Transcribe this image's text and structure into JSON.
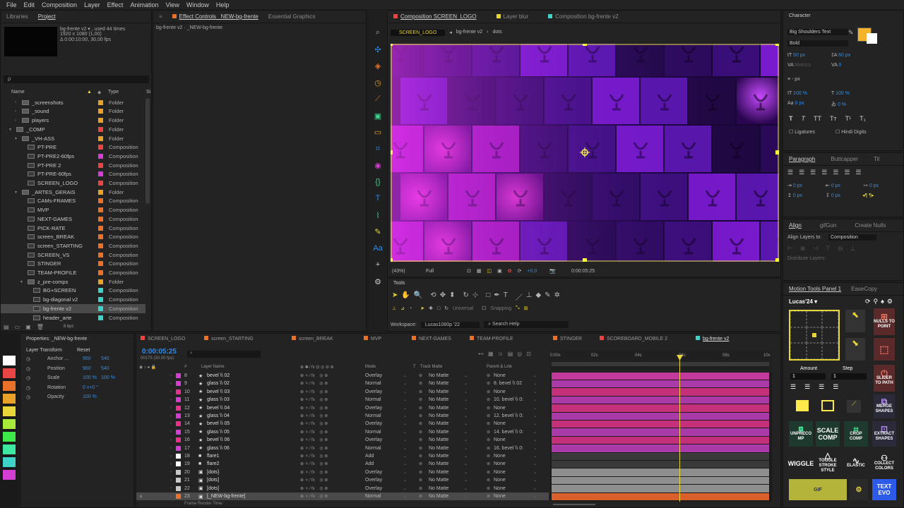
{
  "menu": [
    "File",
    "Edit",
    "Composition",
    "Layer",
    "Effect",
    "Animation",
    "View",
    "Window",
    "Help"
  ],
  "project": {
    "tabs": [
      "Libraries",
      "Project"
    ],
    "item_info": "bg-frente v2 ▾ , used 44 times",
    "item_dims": "1920 x 1080 (1,00)",
    "item_dur": "Δ 0:00:10:00, 30,00 fps",
    "search_placeholder": "ρ",
    "col_name": "Name",
    "col_type": "Type",
    "col_size": "Si",
    "items": [
      {
        "indent": 1,
        "name": "_screenshots",
        "type": "Folder",
        "color": "#e8a22a",
        "folder": true,
        "open": false
      },
      {
        "indent": 1,
        "name": "_sound",
        "type": "Folder",
        "color": "#e8a22a",
        "folder": true,
        "open": false
      },
      {
        "indent": 1,
        "name": "players",
        "type": "Folder",
        "color": "#e8a22a",
        "folder": true,
        "open": false
      },
      {
        "indent": 0,
        "name": "_COMP",
        "type": "Folder",
        "color": "#e84545",
        "folder": true,
        "open": true
      },
      {
        "indent": 1,
        "name": "_VH-ASS",
        "type": "Folder",
        "color": "#e8a22a",
        "folder": true,
        "open": true
      },
      {
        "indent": 2,
        "name": "PT-PRE",
        "type": "Composition",
        "color": "#e84545"
      },
      {
        "indent": 2,
        "name": "PT-PRE2-60fps",
        "type": "Composition",
        "color": "#d23fd2"
      },
      {
        "indent": 2,
        "name": "PT-PRE 2",
        "type": "Composition",
        "color": "#e84545"
      },
      {
        "indent": 2,
        "name": "PT-PRE-60fps",
        "type": "Composition",
        "color": "#d23fd2"
      },
      {
        "indent": 2,
        "name": "SCREEN_LOGO",
        "type": "Composition",
        "color": "#e84545"
      },
      {
        "indent": 1,
        "name": "_ARTES_GERAIS",
        "type": "Folder",
        "color": "#e8a22a",
        "folder": true,
        "open": true
      },
      {
        "indent": 2,
        "name": "CAMs-FRAMES",
        "type": "Composition",
        "color": "#e8722a"
      },
      {
        "indent": 2,
        "name": "MVP",
        "type": "Composition",
        "color": "#e8722a"
      },
      {
        "indent": 2,
        "name": "NEXT-GAMES",
        "type": "Composition",
        "color": "#e8722a"
      },
      {
        "indent": 2,
        "name": "PICK-RATE",
        "type": "Composition",
        "color": "#e8722a"
      },
      {
        "indent": 2,
        "name": "screen_BREAK",
        "type": "Composition",
        "color": "#e8722a"
      },
      {
        "indent": 2,
        "name": "screen_STARTING",
        "type": "Composition",
        "color": "#e8722a"
      },
      {
        "indent": 2,
        "name": "SCREEN_VS",
        "type": "Composition",
        "color": "#e8722a"
      },
      {
        "indent": 2,
        "name": "STINGER",
        "type": "Composition",
        "color": "#e8722a"
      },
      {
        "indent": 2,
        "name": "TEAM-PROFILE",
        "type": "Composition",
        "color": "#e8722a"
      },
      {
        "indent": 2,
        "name": "z_pre-comps",
        "type": "Folder",
        "color": "#e8a22a",
        "folder": true,
        "open": true
      },
      {
        "indent": 3,
        "name": "BG+SCREEN",
        "type": "Composition",
        "color": "#3fd2c8"
      },
      {
        "indent": 3,
        "name": "bg-diagonal v2",
        "type": "Composition",
        "color": "#3fd2c8"
      },
      {
        "indent": 3,
        "name": "bg-frente v2",
        "type": "Composition",
        "color": "#3fd2c8",
        "selected": true
      },
      {
        "indent": 3,
        "name": "header_arte",
        "type": "Composition",
        "color": "#3fd2c8"
      }
    ],
    "bpc": "8 bpc"
  },
  "effect_controls": {
    "tab": "Effect Controls _NEW-bg-frente",
    "tab2": "Essential Graphics",
    "subtitle": "bg-frente v2 · _NEW-bg-frente"
  },
  "viewer": {
    "tabs": [
      "Composition SCREEN_LOGO",
      "Layer blur",
      "Composition bg-frente v2"
    ],
    "breadcrumbs": [
      "SCREEN_LOGO",
      "bg-frente v2",
      "dots"
    ],
    "zoom": "(43%)",
    "resolution": "Full",
    "exposure": "+0,0",
    "timecode": "0:00:05:25"
  },
  "tools_panel": {
    "title": "Tools",
    "universal": "Universal",
    "snapping": "Snapping",
    "workspace_label": "Workspace:",
    "workspace": "Lucas1080p '22",
    "search_help": "Search Help"
  },
  "character": {
    "title": "Character",
    "font": "Big Shoulders Text",
    "style": "Bold",
    "size": "50 px",
    "leading": "60 px",
    "kerning": "Metrics",
    "tracking": "0",
    "stroke": "- px",
    "vscale": "100 %",
    "hscale": "100 %",
    "baseline": "0 px",
    "tsume": "0 %",
    "ligatures": "Ligatures",
    "hindi": "Hindi Digits",
    "color_fill": "#f4b429"
  },
  "paragraph": {
    "tabs": [
      "Paragraph",
      "Buttcapper",
      "Til"
    ],
    "vals": [
      "0 px",
      "0 px",
      "0 px",
      "0 px",
      "0 px"
    ]
  },
  "align": {
    "tabs": [
      "Align",
      "gifGun",
      "Create Nulls"
    ],
    "align_to_label": "Align Layers to:",
    "align_to": "Composition",
    "distribute": "Distribute Layers:"
  },
  "motion_tools": {
    "tabs": [
      "Motion Tools Panel 1",
      "EaseCopy"
    ],
    "preset": "Lucas'24",
    "amount_label": "Amount",
    "step_label": "Step",
    "amount": "1",
    "step": "1",
    "buttons": [
      "NULLS TO POINT",
      "",
      "SLIDER TO PATH",
      "MERGE SHAPES",
      "UNPRECO MP",
      "SCALE COMP",
      "CROP COMP",
      "EXTRACT SHAPES",
      "WIGGLE",
      "TOGGLE STROKE STYLE",
      "ELASTIC",
      "COLLECT COLORS",
      "GIF",
      "",
      "TEXT EVO"
    ]
  },
  "properties": {
    "title": "Properties: _NEW-bg-frente",
    "section": "Layer Transform",
    "reset": "Reset",
    "rows": [
      {
        "label": "Anchor ...",
        "v1": "960",
        "v2": "540"
      },
      {
        "label": "Position",
        "v1": "960",
        "v2": "540"
      },
      {
        "label": "Scale",
        "v1": "100 %",
        "v2": "100 %"
      },
      {
        "label": "Rotation",
        "v1": "0 x+0 °",
        "v2": ""
      },
      {
        "label": "Opacity",
        "v1": "100 %",
        "v2": ""
      }
    ]
  },
  "timeline": {
    "tabs": [
      {
        "label": "SCREEN_LOGO",
        "color": "#e84545"
      },
      {
        "label": "screen_STARTING",
        "color": "#e8722a"
      },
      {
        "label": "screen_BREAK",
        "color": "#e8722a"
      },
      {
        "label": "MVP",
        "color": "#e8722a"
      },
      {
        "label": "NEXT-GAMES",
        "color": "#e8722a"
      },
      {
        "label": "TEAM-PROFILE",
        "color": "#e8722a"
      },
      {
        "label": "STINGER",
        "color": "#e8722a"
      },
      {
        "label": "SCOREBOARD_MOBILE 2",
        "color": "#e84545"
      },
      {
        "label": "bg-frente v2",
        "color": "#3fd2c8"
      }
    ],
    "timecode": "0:00:05:25",
    "frames": "00175 (30.00 fps)",
    "col_layer": "Layer Name",
    "col_mode": "Mode",
    "col_t": "T",
    "col_track": "Track Matte",
    "col_parent": "Parent & Link",
    "ruler": [
      "0:00s",
      "02s",
      "04s",
      "06s",
      "08s",
      "10s"
    ],
    "layers": [
      {
        "n": "8",
        "name": "bevel \\\\ 02",
        "mode": "Overlay",
        "matte": "No Matte",
        "parent": "None",
        "color": "#d23fd2",
        "bar": "#c43a9c",
        "type": "star"
      },
      {
        "n": "9",
        "name": "glass \\\\ 02",
        "mode": "Normal",
        "matte": "No Matte",
        "parent": "8. bevel \\\\ 02",
        "color": "#d23fd2",
        "bar": "#a93aa8",
        "type": "star"
      },
      {
        "n": "10",
        "name": "bevel \\\\ 03",
        "mode": "Overlay",
        "matte": "No Matte",
        "parent": "None",
        "color": "#e8308e",
        "bar": "#c4307a",
        "type": "star"
      },
      {
        "n": "11",
        "name": "glass \\\\ 03",
        "mode": "Normal",
        "matte": "No Matte",
        "parent": "10. bevel \\\\ 0:",
        "color": "#d23fd2",
        "bar": "#a93aa8",
        "type": "star"
      },
      {
        "n": "12",
        "name": "bevel \\\\ 04",
        "mode": "Overlay",
        "matte": "No Matte",
        "parent": "None",
        "color": "#e8308e",
        "bar": "#c4307a",
        "type": "star"
      },
      {
        "n": "13",
        "name": "glass \\\\ 04",
        "mode": "Normal",
        "matte": "No Matte",
        "parent": "12. bevel \\\\ 0:",
        "color": "#d23fd2",
        "bar": "#a93aa8",
        "type": "star"
      },
      {
        "n": "14",
        "name": "bevel \\\\ 05",
        "mode": "Overlay",
        "matte": "No Matte",
        "parent": "None",
        "color": "#e8308e",
        "bar": "#c4307a",
        "type": "star"
      },
      {
        "n": "15",
        "name": "glass \\\\ 05",
        "mode": "Normal",
        "matte": "No Matte",
        "parent": "14. bevel \\\\ 0:",
        "color": "#d23fd2",
        "bar": "#a93aa8",
        "type": "star"
      },
      {
        "n": "16",
        "name": "bevel \\\\ 06",
        "mode": "Overlay",
        "matte": "No Matte",
        "parent": "None",
        "color": "#e8308e",
        "bar": "#c4307a",
        "type": "star"
      },
      {
        "n": "17",
        "name": "glass \\\\ 06",
        "mode": "Normal",
        "matte": "No Matte",
        "parent": "16. bevel \\\\ 0:",
        "color": "#d23fd2",
        "bar": "#a93aa8",
        "type": "star"
      },
      {
        "n": "18",
        "name": "flare1",
        "mode": "Add",
        "matte": "No Matte",
        "parent": "None",
        "color": "#ffffff",
        "bar": "#3a3a3a",
        "type": "solid"
      },
      {
        "n": "19",
        "name": "flare2",
        "mode": "Add",
        "matte": "No Matte",
        "parent": "None",
        "color": "#ffffff",
        "bar": "#3a3a3a",
        "type": "solid"
      },
      {
        "n": "20",
        "name": "[dots]",
        "mode": "Overlay",
        "matte": "No Matte",
        "parent": "None",
        "color": "#c8c8c8",
        "bar": "#8e8e8e",
        "type": "comp"
      },
      {
        "n": "21",
        "name": "[dots]",
        "mode": "Overlay",
        "matte": "No Matte",
        "parent": "None",
        "color": "#c8c8c8",
        "bar": "#8e8e8e",
        "type": "comp"
      },
      {
        "n": "22",
        "name": "[dots]",
        "mode": "Overlay",
        "matte": "No Matte",
        "parent": "None",
        "color": "#c8c8c8",
        "bar": "#8e8e8e",
        "type": "comp"
      },
      {
        "n": "23",
        "name": "[_NEW-bg-frente]",
        "mode": "Normal",
        "matte": "No Matte",
        "parent": "None",
        "color": "#e8722a",
        "bar": "#d9602a",
        "type": "comp",
        "selected": true
      }
    ],
    "footer": "Frame Render Time:"
  }
}
